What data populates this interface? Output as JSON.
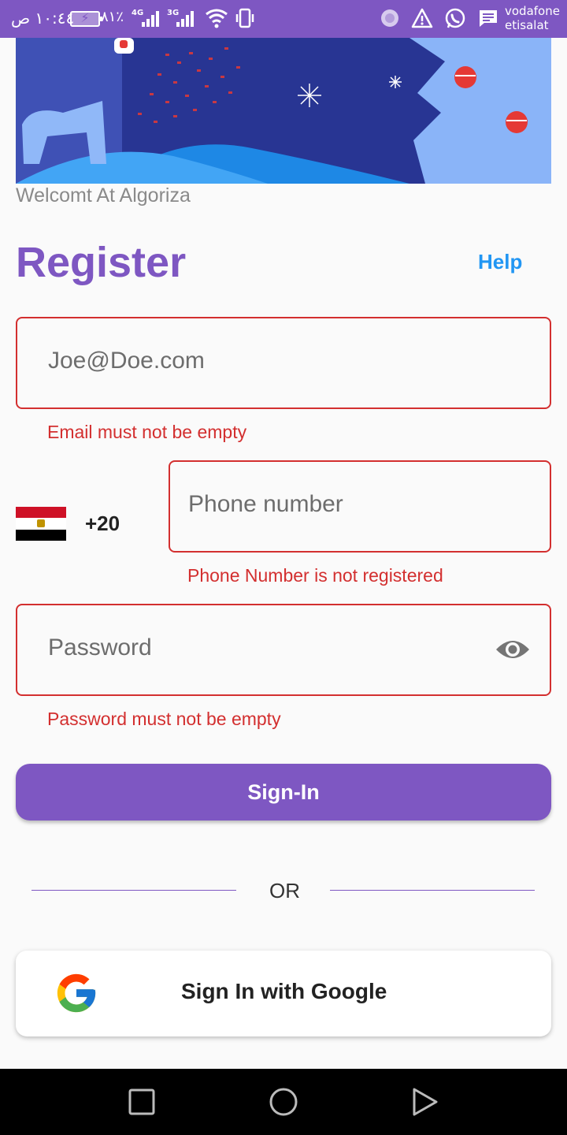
{
  "status_bar": {
    "time": "١٠:٤٤ ص",
    "battery_percent": "٨١٪",
    "network_1": "4G",
    "network_2": "3G",
    "carrier_1": "vodafone",
    "carrier_2": "etisalat",
    "icons": [
      "battery-charging-icon",
      "signal-4g-icon",
      "signal-3g-icon",
      "wifi-icon",
      "vibrate-icon",
      "sync-icon",
      "warning-icon",
      "whatsapp-icon",
      "message-icon"
    ]
  },
  "welcome_text": "Welcomt At Algoriza",
  "title": "Register",
  "help_label": "Help",
  "email": {
    "placeholder": "Joe@Doe.com",
    "error": "Email must not be empty"
  },
  "phone": {
    "country_flag": "egypt-flag",
    "dial_code": "+20",
    "placeholder": "Phone number",
    "error": "Phone Number is not registered"
  },
  "password": {
    "placeholder": "Password",
    "error": "Password must not be empty",
    "visibility_icon": "eye-icon"
  },
  "signin_label": "Sign-In",
  "or_label": "OR",
  "google_label": "Sign In with Google",
  "colors": {
    "primary": "#7e57c2",
    "error": "#d32f2f",
    "link": "#2196f3"
  },
  "nav_bar": [
    "recents-square-icon",
    "home-circle-icon",
    "back-triangle-icon"
  ]
}
